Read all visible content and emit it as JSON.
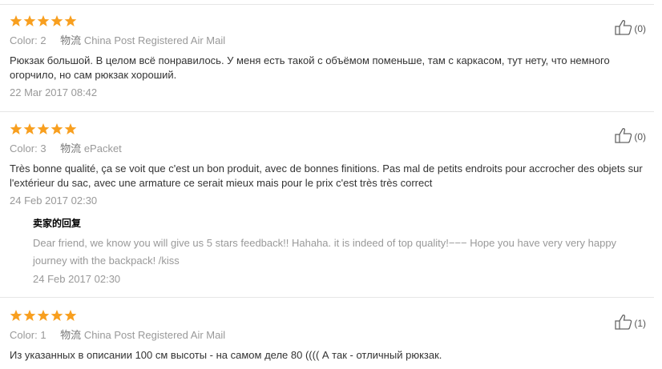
{
  "colors": {
    "star": "#f89f1f",
    "divider": "#e6e6e6"
  },
  "reviews": [
    {
      "color_label": "Color:",
      "color_value": "2",
      "ship_label": "物流",
      "ship_value": "China Post Registered Air Mail",
      "text": "Рюкзак большой. В целом всё понравилось. У меня есть такой с объёмом поменьше, там с каркасом, тут нету, что немного огорчило, но сам рюкзак хороший.",
      "date": "22 Mar 2017 08:42",
      "likes": "(0)",
      "rating": 5
    },
    {
      "color_label": "Color:",
      "color_value": "3",
      "ship_label": "物流",
      "ship_value": "ePacket",
      "text": "Très bonne qualité, ça se voit que c'est un bon produit, avec de bonnes finitions. Pas mal de petits endroits pour accrocher des objets sur l'extérieur du sac, avec une armature ce serait mieux mais pour le prix c'est très très correct",
      "date": "24 Feb 2017 02:30",
      "likes": "(0)",
      "rating": 5,
      "reply": {
        "title": "卖家的回复",
        "text": "Dear friend, we know you will give us 5 stars feedback!! Hahaha. it is indeed of top quality!−−− Hope you have very very happy journey with the backpack! /kiss",
        "date": "24 Feb 2017 02:30"
      }
    },
    {
      "color_label": "Color:",
      "color_value": "1",
      "ship_label": "物流",
      "ship_value": "China Post Registered Air Mail",
      "text": "Из указанных в описании 100 см высоты - на самом деле 80 (((( А так - отличный рюкзак.",
      "likes": "(1)",
      "rating": 5
    }
  ]
}
